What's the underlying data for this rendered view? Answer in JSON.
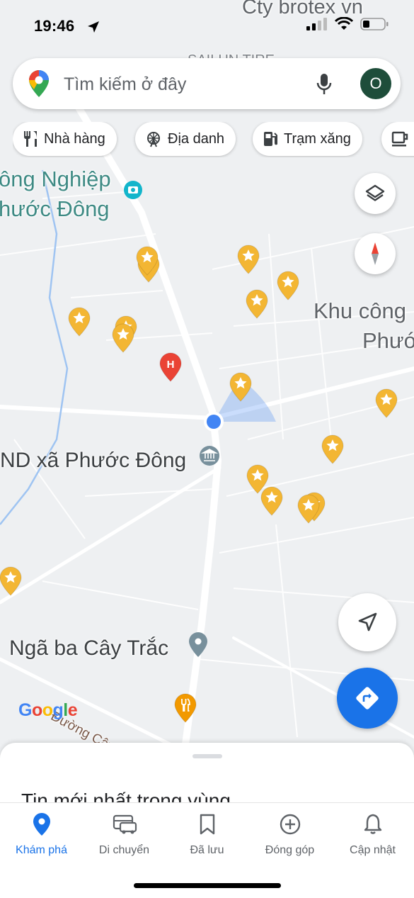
{
  "status": {
    "time": "19:46"
  },
  "search": {
    "placeholder": "Tìm kiếm ở đây",
    "avatar_letter": "O"
  },
  "chips": [
    {
      "label": "Nhà hàng",
      "icon": "fork-knife-icon"
    },
    {
      "label": "Địa danh",
      "icon": "ferris-wheel-icon"
    },
    {
      "label": "Trạm xăng",
      "icon": "gas-station-icon"
    },
    {
      "label": "",
      "icon": "coffee-icon"
    }
  ],
  "map": {
    "labels": {
      "top_cty": "Cty brotex vn",
      "top_partial": "SAILUN TIRE",
      "kcn_left_1": "ông Nghiệp",
      "kcn_left_2": "hước Đông",
      "kcn_right_1": "Khu công",
      "kcn_right_2": "Phướ",
      "ubnd": "ND xã Phước Đông",
      "nga_ba": "Ngã ba Cây Trắc",
      "duong": "Đường Cây Me",
      "google": "Google"
    },
    "colors": {
      "star_pin": "#f3b633",
      "hospital_pin": "#ea4335",
      "food_pin": "#f29900",
      "location_dot": "#4285f4",
      "directions": "#1a73e8"
    }
  },
  "sheet": {
    "title": "Tin mới nhất trong vùng"
  },
  "tabs": [
    {
      "label": "Khám phá",
      "icon": "map-pin-icon",
      "active": true
    },
    {
      "label": "Di chuyển",
      "icon": "car-icon"
    },
    {
      "label": "Đã lưu",
      "icon": "bookmark-icon"
    },
    {
      "label": "Đóng góp",
      "icon": "add-circle-icon"
    },
    {
      "label": "Cập nhật",
      "icon": "bell-icon"
    }
  ]
}
